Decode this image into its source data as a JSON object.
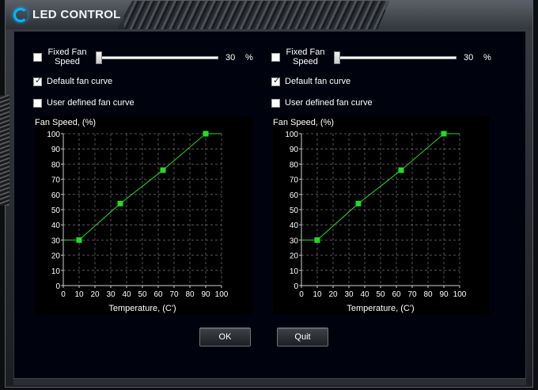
{
  "window": {
    "title": "LED CONTROL"
  },
  "panels": [
    {
      "fixed_label": "Fixed Fan Speed",
      "fixed_label_line1": "Fixed Fan",
      "fixed_label_line2": "Speed",
      "fixed_checked": false,
      "slider_value": "30",
      "slider_unit": "%",
      "default_curve_label": "Default fan curve",
      "default_curve_checked": true,
      "user_curve_label": "User defined fan curve",
      "user_curve_checked": false
    },
    {
      "fixed_label": "Fixed Fan Speed",
      "fixed_label_line1": "Fixed Fan",
      "fixed_label_line2": "Speed",
      "fixed_checked": false,
      "slider_value": "30",
      "slider_unit": "%",
      "default_curve_label": "Default fan curve",
      "default_curve_checked": true,
      "user_curve_label": "User defined fan curve",
      "user_curve_checked": false
    }
  ],
  "chart_data": [
    {
      "type": "line",
      "title": "",
      "ylabel": "Fan Speed, (%)",
      "xlabel": "Temperature, (C')",
      "xlim": [
        0,
        100
      ],
      "ylim": [
        0,
        100
      ],
      "xticks": [
        "0",
        "10",
        "20",
        "30",
        "40",
        "50",
        "60",
        "70",
        "80",
        "90",
        "100"
      ],
      "yticks": [
        "0",
        "10",
        "20",
        "30",
        "40",
        "50",
        "60",
        "70",
        "80",
        "90",
        "100"
      ],
      "grid": true,
      "x": [
        0,
        10,
        36,
        63,
        90,
        100
      ],
      "y": [
        30,
        30,
        54,
        76,
        100,
        100
      ],
      "control_points": [
        [
          10,
          30
        ],
        [
          36,
          54
        ],
        [
          63,
          76
        ],
        [
          90,
          100
        ]
      ],
      "line_color": "#2bd42b",
      "point_color": "#22dd22"
    },
    {
      "type": "line",
      "title": "",
      "ylabel": "Fan Speed, (%)",
      "xlabel": "Temperature, (C')",
      "xlim": [
        0,
        100
      ],
      "ylim": [
        0,
        100
      ],
      "xticks": [
        "0",
        "10",
        "20",
        "30",
        "40",
        "50",
        "60",
        "70",
        "80",
        "90",
        "100"
      ],
      "yticks": [
        "0",
        "10",
        "20",
        "30",
        "40",
        "50",
        "60",
        "70",
        "80",
        "90",
        "100"
      ],
      "grid": true,
      "x": [
        0,
        10,
        36,
        63,
        90,
        100
      ],
      "y": [
        30,
        30,
        54,
        76,
        100,
        100
      ],
      "control_points": [
        [
          10,
          30
        ],
        [
          36,
          54
        ],
        [
          63,
          76
        ],
        [
          90,
          100
        ]
      ],
      "line_color": "#2bd42b",
      "point_color": "#22dd22"
    }
  ],
  "buttons": {
    "ok_label": "OK",
    "quit_label": "Quit"
  }
}
